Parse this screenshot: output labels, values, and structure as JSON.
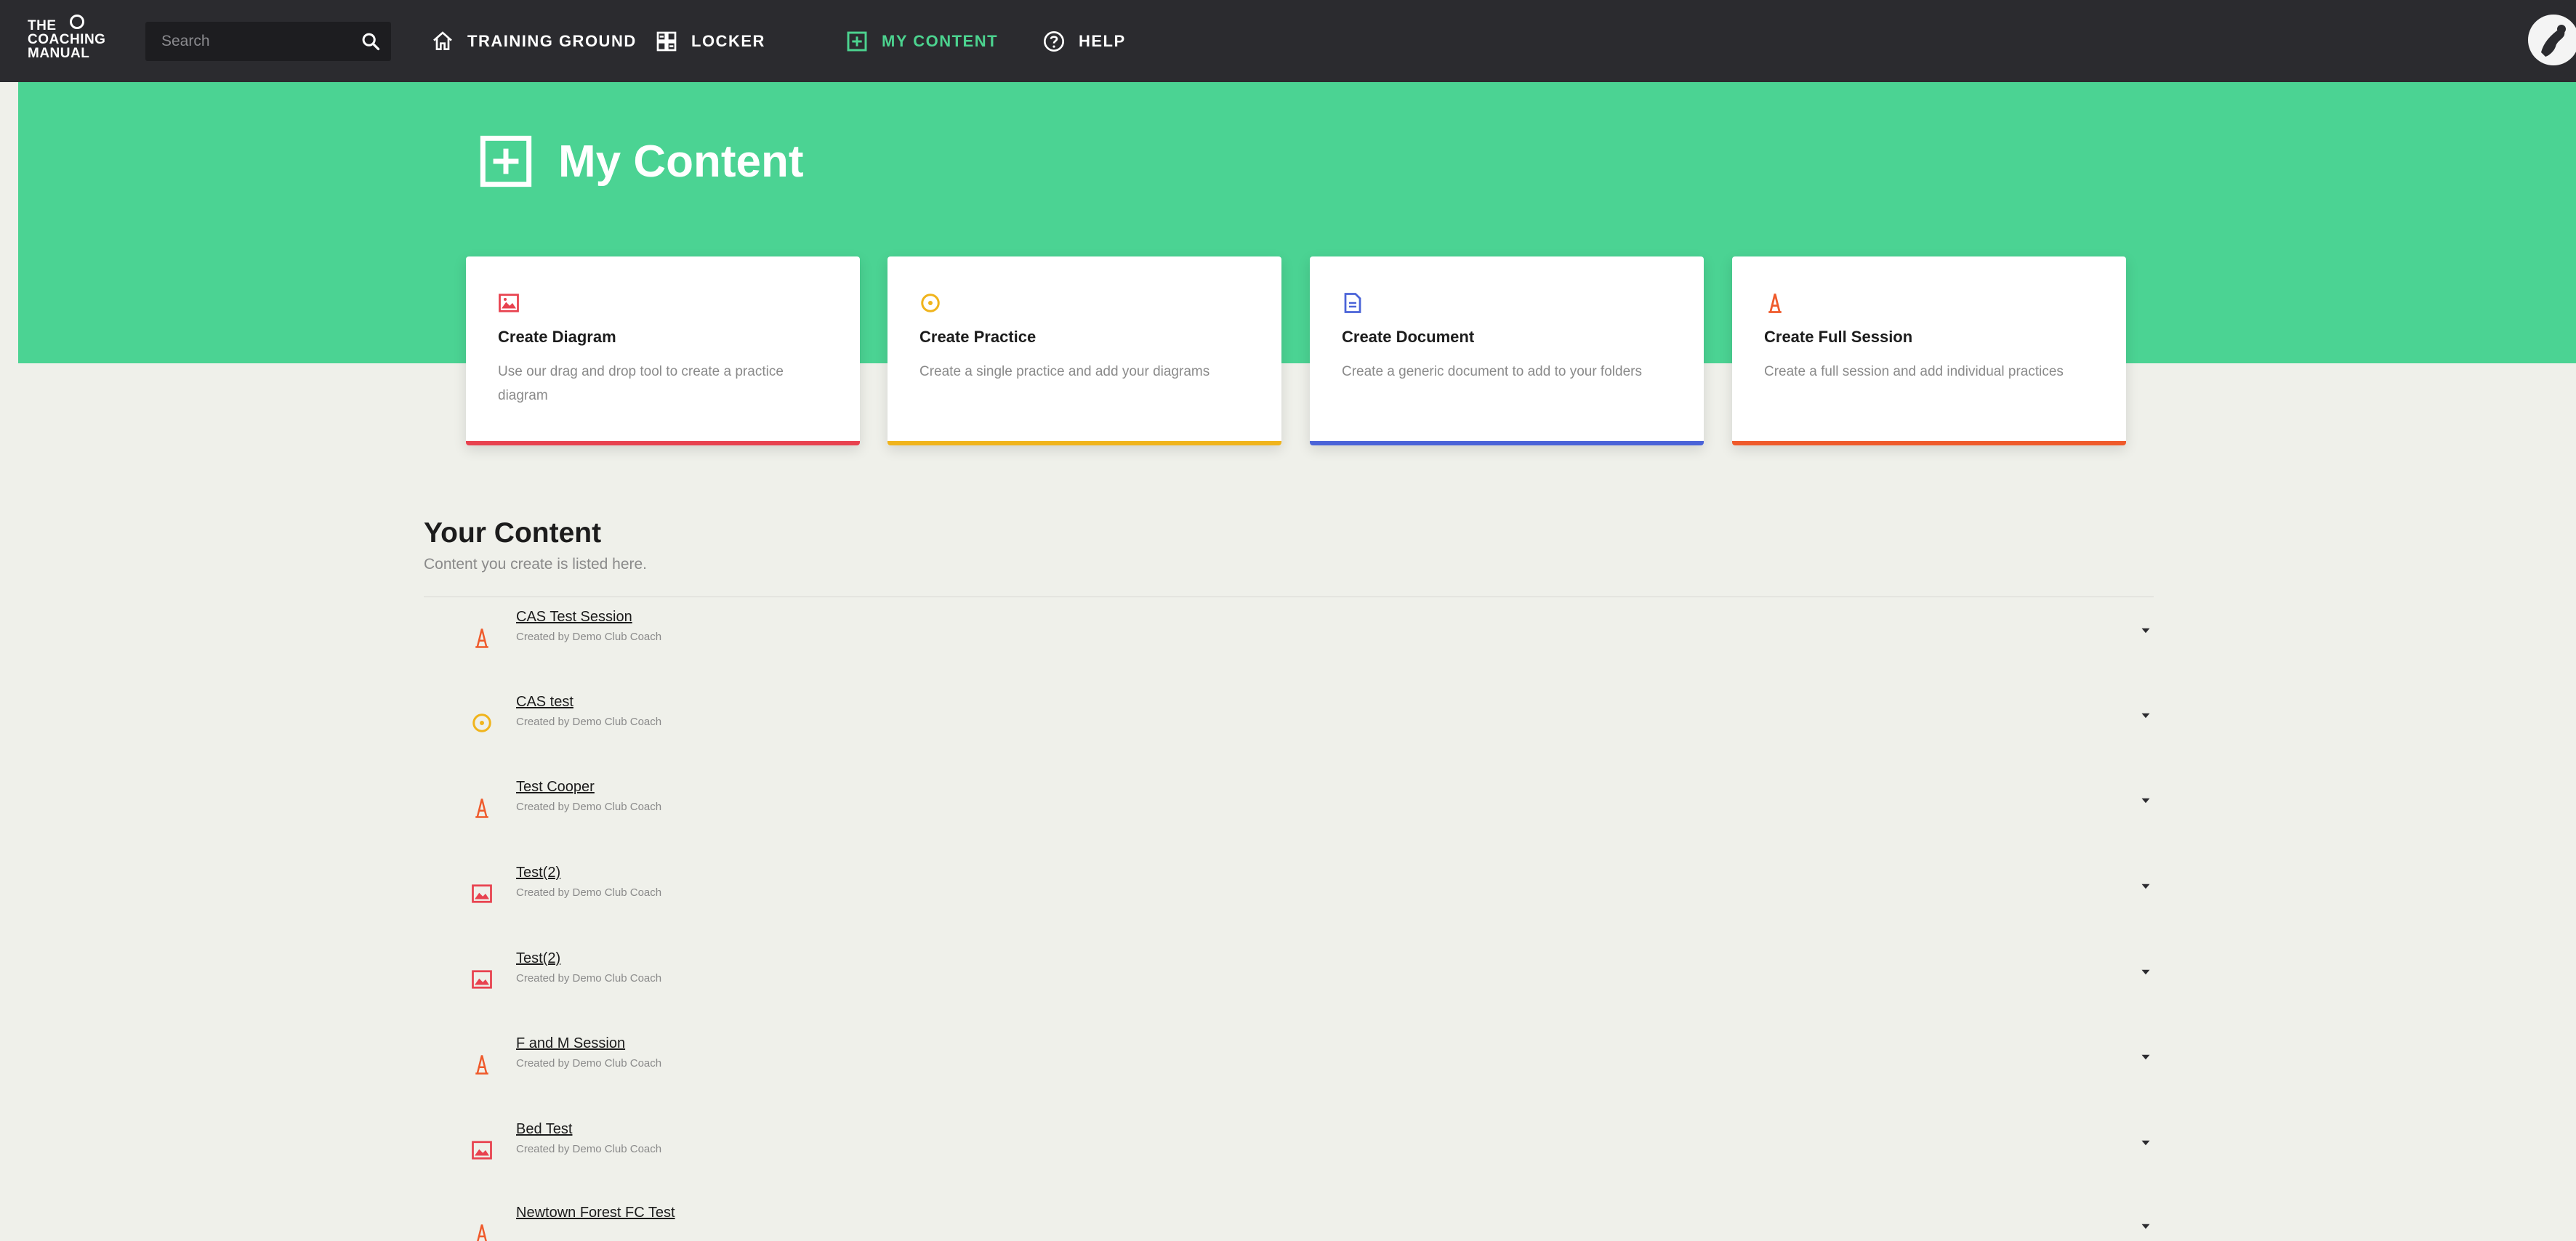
{
  "app": {
    "logo_text_line1": "THE",
    "logo_text_line2": "COACHING",
    "logo_text_line3": "MANUAL"
  },
  "search": {
    "placeholder": "Search"
  },
  "nav": [
    {
      "label": "TRAINING GROUND",
      "icon": "home-icon"
    },
    {
      "label": "LOCKER",
      "icon": "locker-icon"
    },
    {
      "label": "MY CONTENT",
      "icon": "plus-square-icon",
      "active": true
    },
    {
      "label": "HELP",
      "icon": "help-icon"
    }
  ],
  "page": {
    "title": "My Content"
  },
  "cards": [
    {
      "title": "Create Diagram",
      "description": "Use our drag and drop tool to create a practice diagram",
      "icon": "diagram-icon",
      "color": "#e8424f"
    },
    {
      "title": "Create Practice",
      "description": "Create a single practice and add your diagrams",
      "icon": "practice-icon",
      "color": "#f0b41c"
    },
    {
      "title": "Create Document",
      "description": "Create a generic document to add to your folders",
      "icon": "document-icon",
      "color": "#4a63d8"
    },
    {
      "title": "Create Full Session",
      "description": "Create a full session and add individual practices",
      "icon": "session-icon",
      "color": "#ef5a2b"
    }
  ],
  "content": {
    "title": "Your Content",
    "subtitle": "Content you create is listed here.",
    "items": [
      {
        "title": "CAS Test Session",
        "meta": "Created by Demo Club Coach",
        "icon": "session-icon"
      },
      {
        "title": "CAS test",
        "meta": "Created by Demo Club Coach",
        "icon": "practice-icon"
      },
      {
        "title": "Test Cooper",
        "meta": "Created by Demo Club Coach",
        "icon": "session-icon"
      },
      {
        "title": "Test(2)",
        "meta": "Created by Demo Club Coach",
        "icon": "diagram-icon"
      },
      {
        "title": "Test(2)",
        "meta": "Created by Demo Club Coach",
        "icon": "diagram-icon"
      },
      {
        "title": "F and M Session",
        "meta": "Created by Demo Club Coach",
        "icon": "session-icon"
      },
      {
        "title": "Bed Test",
        "meta": "Created by Demo Club Coach",
        "icon": "diagram-icon"
      },
      {
        "title": "Newtown Forest FC Test",
        "meta": "",
        "icon": "session-icon"
      }
    ]
  },
  "colors": {
    "nav_bg": "#2b2b2f",
    "accent": "#4bd393",
    "diagram": "#e8424f",
    "practice": "#f0b41c",
    "document": "#4a63d8",
    "session": "#ef5a2b"
  }
}
